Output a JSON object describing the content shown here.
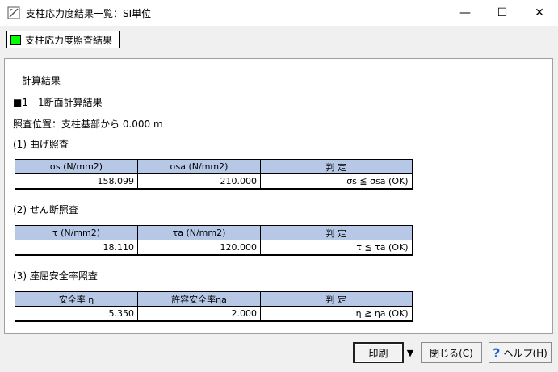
{
  "window": {
    "title": "支柱応力度結果一覧：SI単位",
    "minimize": "—",
    "maximize": "☐",
    "close": "✕"
  },
  "tab": {
    "label": "支柱応力度照査結果"
  },
  "content": {
    "heading": "計算結果",
    "section_title": "■1－1断面計算結果",
    "position_label": "照査位置：支柱基部から 0.000 m",
    "bending": {
      "title": "(1) 曲げ照査",
      "headers": [
        "σs (N/mm2)",
        "σsa (N/mm2)",
        "判 定"
      ],
      "row": [
        "158.099",
        "210.000",
        "σs ≦ σsa (OK)"
      ]
    },
    "shear": {
      "title": "(2) せん断照査",
      "headers": [
        "τ (N/mm2)",
        "τa (N/mm2)",
        "判 定"
      ],
      "row": [
        "18.110",
        "120.000",
        "τ ≦ τa (OK)"
      ]
    },
    "buckling": {
      "title": "(3) 座屈安全率照査",
      "headers": [
        "安全率 η",
        "許容安全率ηa",
        "判 定"
      ],
      "row": [
        "5.350",
        "2.000",
        "η ≧ ηa (OK)"
      ]
    }
  },
  "buttons": {
    "print": "印刷",
    "print_dropdown": "▼",
    "close": "閉じる(C)",
    "help_icon": "?",
    "help": "ヘルプ(H)"
  }
}
